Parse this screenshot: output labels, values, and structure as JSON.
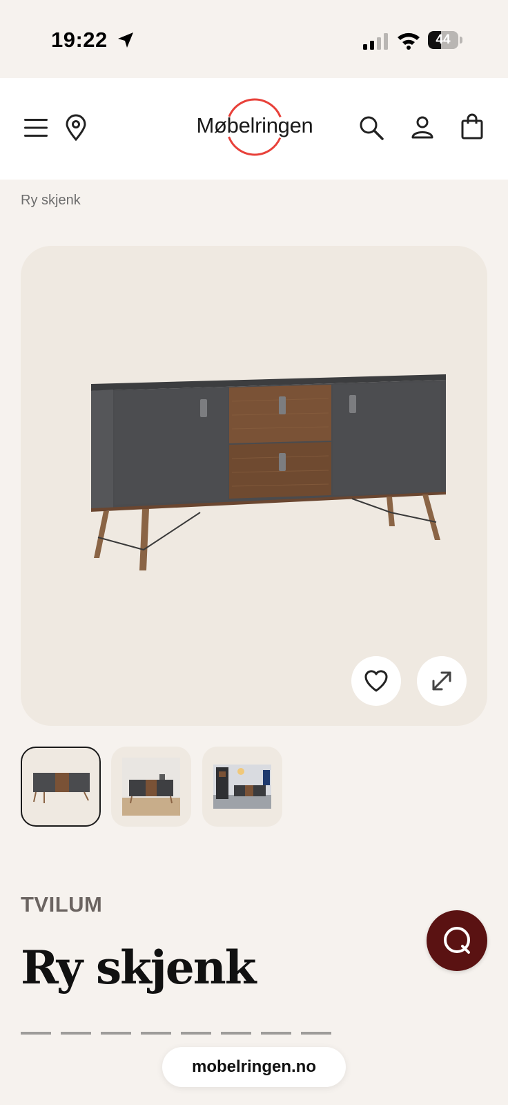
{
  "status_bar": {
    "time": "19:22",
    "battery_percent": "44",
    "battery_level": 0.44
  },
  "header": {
    "menu_icon": "hamburger-icon",
    "location_icon": "map-pin-icon",
    "logo_text": "Møbelringen",
    "logo_ring_color": "#e8413a",
    "search_icon": "search-icon",
    "account_icon": "user-icon",
    "cart_icon": "shopping-bag-icon"
  },
  "breadcrumb": "Ry skjenk",
  "gallery": {
    "main_image": "sideboard-product-image",
    "favorite_icon": "heart-icon",
    "expand_icon": "expand-icon",
    "thumbnails": [
      {
        "name": "thumbnail-1",
        "active": true
      },
      {
        "name": "thumbnail-2",
        "active": false
      },
      {
        "name": "thumbnail-3",
        "active": false
      }
    ]
  },
  "product": {
    "brand": "TVILUM",
    "title": "Ry skjenk"
  },
  "chat": {
    "icon": "chat-icon",
    "color": "#5a1212"
  },
  "browser": {
    "url": "mobelringen.no"
  }
}
